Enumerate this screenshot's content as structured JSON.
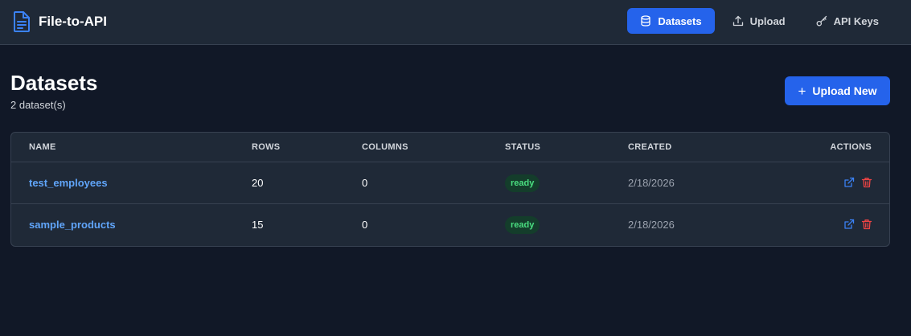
{
  "app": {
    "title": "File-to-API",
    "brand_icon": "document-icon"
  },
  "nav": {
    "items": [
      {
        "label": "Datasets",
        "icon": "database-icon",
        "active": true
      },
      {
        "label": "Upload",
        "icon": "upload-icon",
        "active": false
      },
      {
        "label": "API Keys",
        "icon": "key-icon",
        "active": false
      }
    ]
  },
  "page": {
    "title": "Datasets",
    "subtitle": "2 dataset(s)",
    "upload_button": {
      "icon": "+",
      "label": "Upload New"
    }
  },
  "table": {
    "headers": [
      "NAME",
      "ROWS",
      "COLUMNS",
      "STATUS",
      "CREATED",
      "ACTIONS"
    ],
    "rows": [
      {
        "name": "test_employees",
        "rows": "20",
        "columns": "0",
        "status": "ready",
        "created": "2/18/2026"
      },
      {
        "name": "sample_products",
        "rows": "15",
        "columns": "0",
        "status": "ready",
        "created": "2/18/2026"
      }
    ]
  },
  "colors": {
    "background": "#111827",
    "navbar": "#1f2937",
    "accent": "#2563eb",
    "link": "#60a5fa",
    "status_ready": "#4ade80",
    "delete": "#ef4444"
  }
}
